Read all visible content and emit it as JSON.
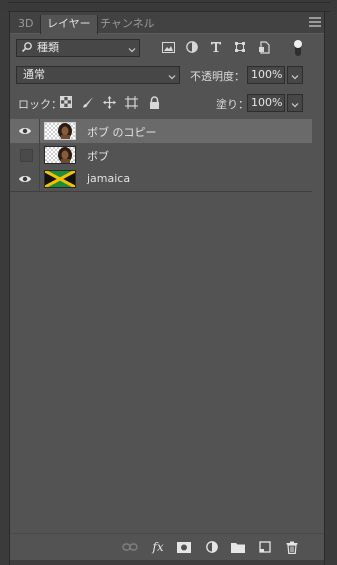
{
  "tabs": [
    {
      "label": "3D"
    },
    {
      "label": "レイヤー"
    },
    {
      "label": "チャンネル"
    }
  ],
  "filter": {
    "kind_label": "種類",
    "icons": [
      "image-filter-icon",
      "adjustment-filter-icon",
      "type-filter-icon",
      "shape-filter-icon",
      "smart-object-filter-icon",
      "filter-toggle-icon"
    ]
  },
  "blend": {
    "mode": "通常",
    "opacity_label": "不透明度：",
    "opacity_value": "100%"
  },
  "lock": {
    "label": "ロック：",
    "icons": [
      "lock-transparent-pixels-icon",
      "lock-image-pixels-icon",
      "lock-position-icon",
      "lock-artboard-icon",
      "lock-all-icon"
    ],
    "fill_label": "塗り：",
    "fill_value": "100%"
  },
  "layers": [
    {
      "name": "ボブ のコピー",
      "visible": true,
      "selected": true,
      "thumb": "bob"
    },
    {
      "name": "ボブ",
      "visible": false,
      "selected": false,
      "thumb": "bob"
    },
    {
      "name": "jamaica",
      "visible": true,
      "selected": false,
      "thumb": "jamaica-flag"
    }
  ],
  "bottom_icons": [
    "link-layers-icon",
    "fx-icon",
    "add-mask-icon",
    "new-adjustment-layer-icon",
    "new-group-icon",
    "new-layer-icon",
    "delete-layer-icon"
  ],
  "bottom_fx_label": "fx",
  "colors": {
    "panel_bg": "#535353",
    "selected_row": "#6a6a6a",
    "flag_green": "#1f8a3a",
    "flag_gold": "#f2c200",
    "flag_black": "#111111"
  }
}
